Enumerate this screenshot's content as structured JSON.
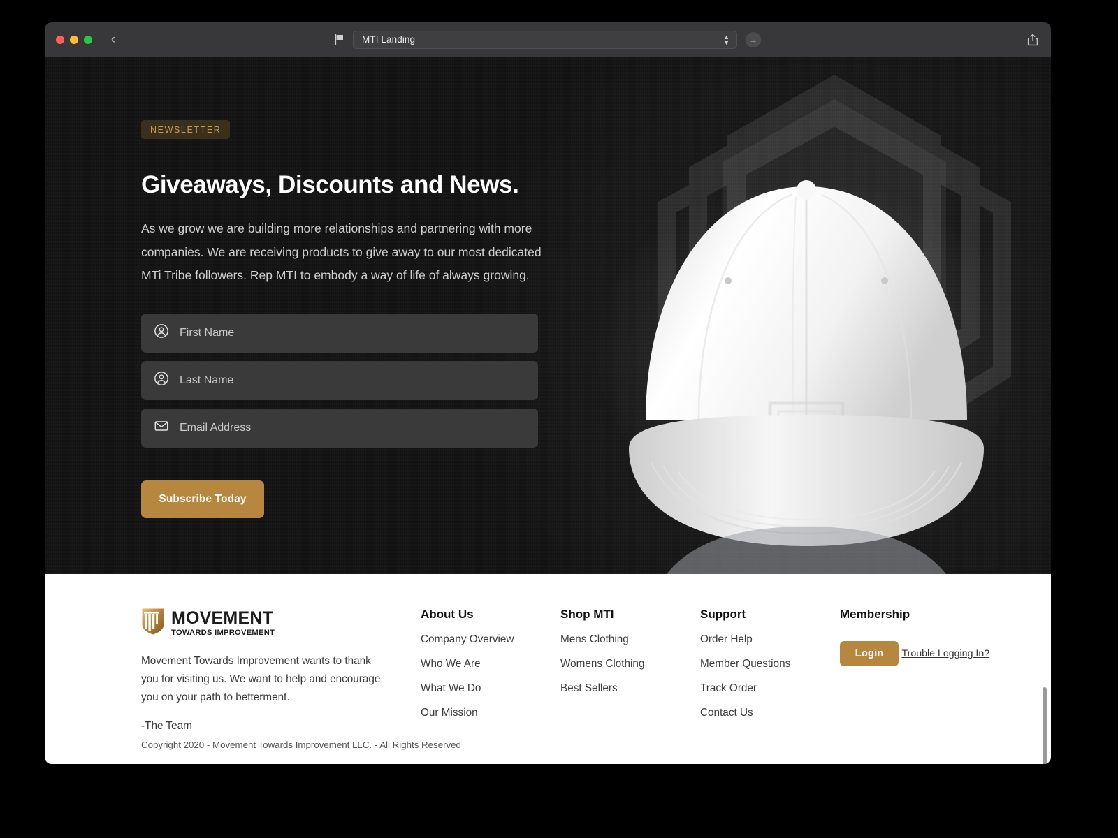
{
  "window": {
    "traffic_lights": [
      "close",
      "minimize",
      "zoom"
    ],
    "back_label": "‹",
    "address_value": "MTI Landing",
    "go_label": "→",
    "icons": {
      "flag": "flag-icon",
      "stepper": "stepper-icon",
      "share": "share-icon"
    }
  },
  "hero": {
    "badge": "NEWSLETTER",
    "title": "Giveaways, Discounts and News.",
    "paragraph": "As we grow we are building more relationships and partnering with more companies. We are receiving products to give away to our most dedicated MTi Tribe followers. Rep MTI to embody a way of life of always growing.",
    "form": {
      "fields": [
        {
          "placeholder": "First Name",
          "icon": "person-icon"
        },
        {
          "placeholder": "Last Name",
          "icon": "person-icon"
        },
        {
          "placeholder": "Email Address",
          "icon": "envelope-icon"
        }
      ],
      "submit_label": "Subscribe Today"
    },
    "artwork_alt": "white MTI trucker hat on dark background"
  },
  "footer": {
    "logo": {
      "main": "MOVEMENT",
      "sub": "TOWARDS IMPROVEMENT",
      "mark": "shield-icon"
    },
    "blurb": "Movement Towards Improvement wants to thank you for visiting us. We want to help and encourage you on your path to betterment.",
    "signature": "-The Team",
    "columns": [
      {
        "title": "About Us",
        "links": [
          "Company Overview",
          "Who We Are",
          "What We Do",
          "Our Mission"
        ]
      },
      {
        "title": "Shop MTI",
        "links": [
          "Mens Clothing",
          "Womens Clothing",
          "Best Sellers"
        ]
      },
      {
        "title": "Support",
        "links": [
          "Order Help",
          "Member Questions",
          "Track Order",
          "Contact Us"
        ]
      }
    ],
    "membership": {
      "title": "Membership",
      "login_label": "Login",
      "trouble_label": "Trouble Logging In?"
    },
    "copyright": "Copyright 2020 - Movement Towards Improvement LLC. - All Rights Reserved"
  },
  "colors": {
    "accent_gold": "#b8873f",
    "badge_bg": "#3a2f1c",
    "badge_text": "#c79a4f",
    "hero_bg": "#121212",
    "field_bg": "#3a3a3a",
    "footer_bg": "#ffffff"
  }
}
